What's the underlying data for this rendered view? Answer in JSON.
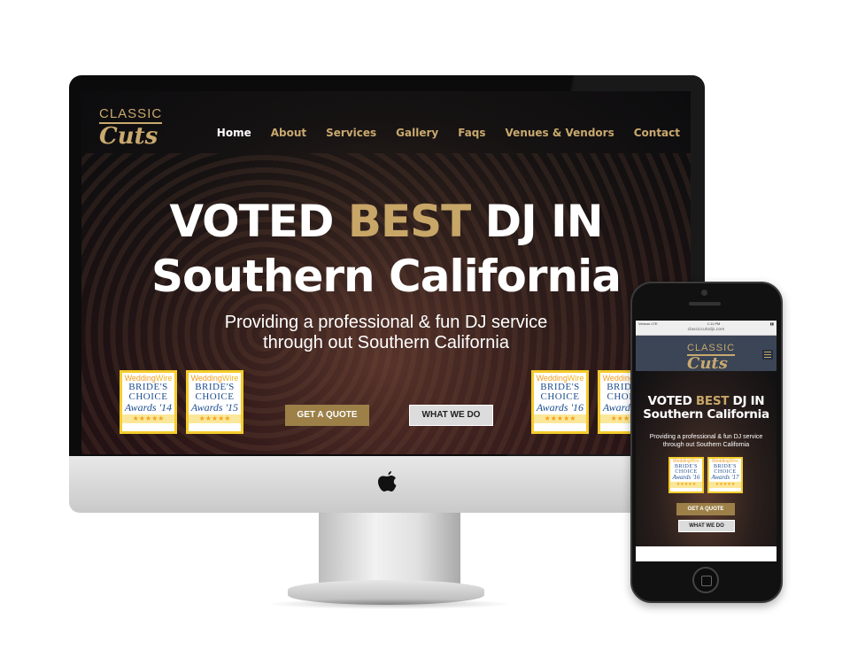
{
  "site": {
    "logo": {
      "line1": "CLASSIC",
      "line2": "Cuts"
    },
    "nav": [
      "Home",
      "About",
      "Services",
      "Gallery",
      "Faqs",
      "Venues & Vendors",
      "Contact"
    ],
    "active_nav": "Home",
    "hero": {
      "title_pre": "VOTED ",
      "title_highlight": "BEST",
      "title_post": " DJ IN",
      "title_line2": "Southern California",
      "subtitle_line1": "Providing a professional & fun DJ service",
      "subtitle_line2": "through out Southern California",
      "cta_primary": "GET A QUOTE",
      "cta_secondary": "WHAT WE DO"
    },
    "badges": [
      {
        "brand_a": "Wedding",
        "brand_b": "Wire",
        "line1": "BRIDE'S",
        "line2": "CHOICE",
        "award": "Awards '14",
        "stars": "★★★★★"
      },
      {
        "brand_a": "Wedding",
        "brand_b": "Wire",
        "line1": "BRIDE'S",
        "line2": "CHOICE",
        "award": "Awards '15",
        "stars": "★★★★★"
      },
      {
        "brand_a": "Wedding",
        "brand_b": "Wire",
        "line1": "BRIDE'S",
        "line2": "CHOICE",
        "award": "Awards '16",
        "stars": "★★★★★"
      },
      {
        "brand_a": "Wedding",
        "brand_b": "Wire",
        "line1": "BRIDE'S",
        "line2": "CHOICE",
        "award": "Awards '17",
        "stars": "★★★★★"
      }
    ]
  },
  "phone_status": {
    "carrier": "Verizon LTE",
    "time": "1:11 PM",
    "url": "classiccutsdjs.com"
  },
  "colors": {
    "gold": "#c7a668",
    "header_mobile": "#3b4556",
    "badge_border": "#f4cc2d",
    "button_gold": "#9c8048"
  }
}
